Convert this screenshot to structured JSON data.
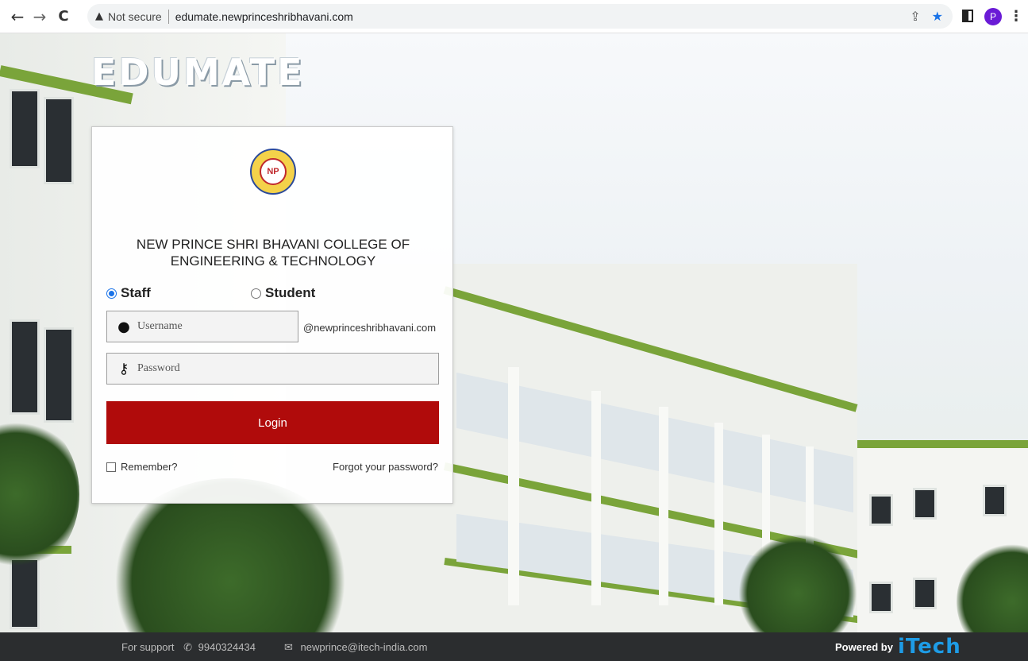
{
  "browser": {
    "not_secure": "Not secure",
    "url": "edumate.newprinceshribhavani.com",
    "profile_initial": "P"
  },
  "brand": {
    "logo_text": "EDUMATE"
  },
  "login": {
    "college_name_line1": "NEW PRINCE SHRI BHAVANI COLLEGE OF",
    "college_name_line2": "ENGINEERING & TECHNOLOGY",
    "role_staff": "Staff",
    "role_student": "Student",
    "selected_role": "Staff",
    "username_placeholder": "Username",
    "username_value": "",
    "domain_suffix": "@newprinceshribhavani.com",
    "password_placeholder": "Password",
    "password_value": "",
    "login_button": "Login",
    "remember_label": "Remember?",
    "remember_checked": false,
    "forgot_link": "Forgot your password?"
  },
  "footer": {
    "support_label": "For support",
    "support_phone": "9940324434",
    "support_email": "newprince@itech-india.com",
    "powered_by": "Powered by",
    "vendor": "iTech"
  },
  "colors": {
    "login_button": "#b00b0b",
    "footer_bg": "#2b2d2f",
    "vendor_blue": "#1e9ce6",
    "radio_selected": "#1a73e8"
  }
}
